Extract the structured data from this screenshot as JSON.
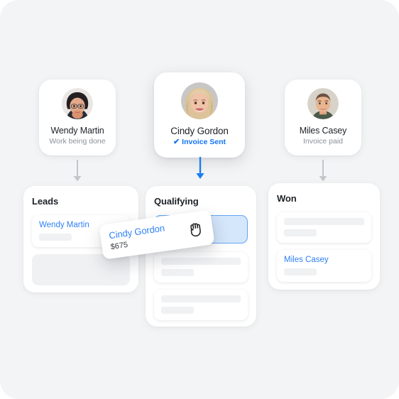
{
  "canvas": {
    "background": "#f3f4f5",
    "accent": "#1374f0"
  },
  "people": [
    {
      "name": "Wendy Martin",
      "status": "Work being done",
      "status_style": "muted",
      "avatar": "avatar-wendy"
    },
    {
      "name": "Cindy Gordon",
      "status": "Invoice Sent",
      "status_style": "accent",
      "check_glyph": "✔",
      "avatar": "avatar-cindy"
    },
    {
      "name": "Miles Casey",
      "status": "Invoice paid",
      "status_style": "muted",
      "avatar": "avatar-miles"
    }
  ],
  "arrows": [
    {
      "name": "arrow-down-leads",
      "color": "#c3c6ca"
    },
    {
      "name": "arrow-down-qualifying",
      "color": "#1a7ef0"
    },
    {
      "name": "arrow-down-won",
      "color": "#c3c6ca"
    }
  ],
  "columns": [
    {
      "title": "Leads",
      "cards": [
        {
          "type": "deal",
          "name": "Wendy Martin"
        },
        {
          "type": "placeholder"
        }
      ]
    },
    {
      "title": "Qualifying",
      "cards": [
        {
          "type": "dropzone"
        },
        {
          "type": "skeleton"
        },
        {
          "type": "skeleton"
        }
      ]
    },
    {
      "title": "Won",
      "cards": [
        {
          "type": "skeleton"
        },
        {
          "type": "deal",
          "name": "Miles Casey"
        }
      ]
    }
  ],
  "drag_card": {
    "name": "Cindy Gordon",
    "amount": "$675",
    "cursor_icon": "grabbing-hand-icon"
  }
}
